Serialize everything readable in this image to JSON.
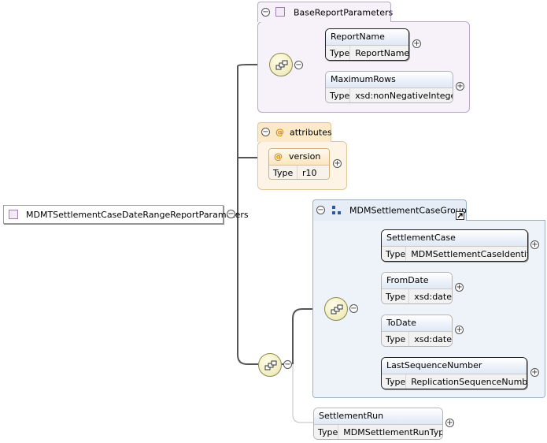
{
  "diagram": {
    "root": {
      "name": "MDMTSettlementCaseDateRangeReportParameters"
    },
    "base_group": {
      "name": "BaseReportParameters",
      "elements": [
        {
          "name": "ReportName",
          "type_label": "Type",
          "type": "ReportName",
          "required": true
        },
        {
          "name": "MaximumRows",
          "type_label": "Type",
          "type": "xsd:nonNegativeInteger",
          "required": false
        }
      ]
    },
    "attributes": {
      "title": "attributes",
      "items": [
        {
          "name": "version",
          "type_label": "Type",
          "type": "r10"
        }
      ]
    },
    "mdm_group": {
      "name": "MDMSettlementCaseGroup",
      "elements": [
        {
          "name": "SettlementCase",
          "type_label": "Type",
          "type": "MDMSettlementCaseIdentifier",
          "required": true
        },
        {
          "name": "FromDate",
          "type_label": "Type",
          "type": "xsd:date",
          "required": false
        },
        {
          "name": "ToDate",
          "type_label": "Type",
          "type": "xsd:date",
          "required": false
        },
        {
          "name": "LastSequenceNumber",
          "type_label": "Type",
          "type": "ReplicationSequenceNumber",
          "required": true
        }
      ]
    },
    "settlement_run": {
      "name": "SettlementRun",
      "type_label": "Type",
      "type": "MDMSettlementRunType",
      "required": false
    }
  },
  "glyphs": {
    "collapse": "−",
    "expand": "+",
    "attribute": "@"
  },
  "colors": {
    "wire": "#555555",
    "optional_wire": "#b0b0b0",
    "element_border": "#222222",
    "group_fill": "#f7f1fa",
    "attr_fill": "#fdf4e6",
    "mdm_fill": "#eef3fa"
  }
}
